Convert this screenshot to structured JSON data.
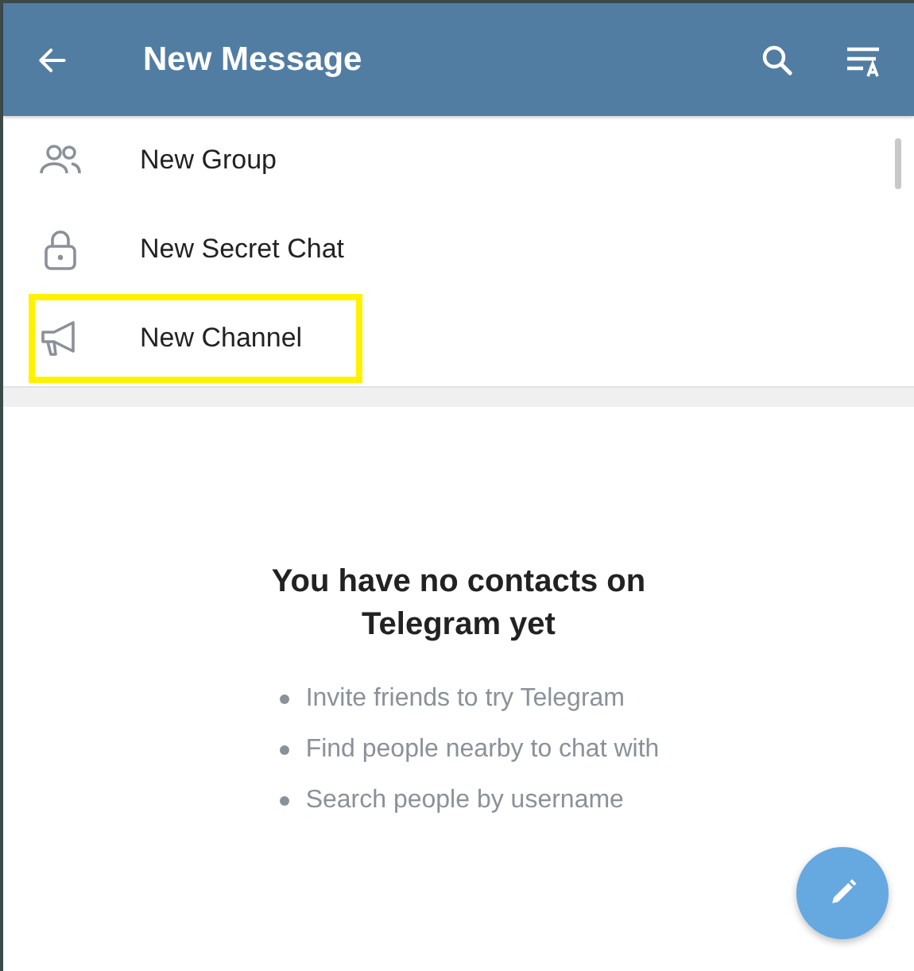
{
  "header": {
    "title": "New Message"
  },
  "menu": [
    {
      "kind": "group",
      "label": "New Group",
      "highlighted": false
    },
    {
      "kind": "lock",
      "label": "New Secret Chat",
      "highlighted": false
    },
    {
      "kind": "megaphone",
      "label": "New Channel",
      "highlighted": true
    }
  ],
  "empty_state": {
    "title": "You have no contacts on Telegram yet",
    "tips": [
      "Invite friends to try Telegram",
      "Find people nearby to chat with",
      "Search people by username"
    ]
  }
}
